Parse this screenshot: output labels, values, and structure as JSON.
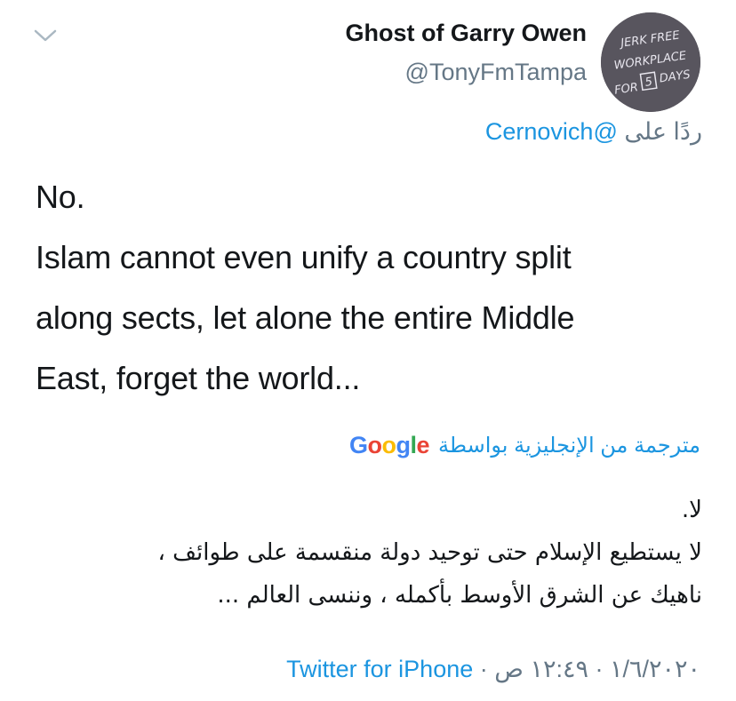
{
  "tweet": {
    "display_name": "Ghost of Garry Owen",
    "handle": "@TonyFmTampa",
    "avatar_text": [
      "JERK FREE",
      "WORKPLACE",
      "FOR",
      "5",
      "DAYS"
    ],
    "reply_prefix": "ردًا على",
    "reply_mention": "@Cernovich",
    "text_lines": [
      "No.",
      "Islam cannot even unify a country split",
      "along sects, let alone the entire Middle",
      "East, forget the world..."
    ],
    "translated_by_label": "مترجمة من الإنجليزية بواسطة",
    "google_logo_letters": [
      "G",
      "o",
      "o",
      "g",
      "l",
      "e"
    ],
    "google_colors": [
      "#4285F4",
      "#EA4335",
      "#FBBC05",
      "#4285F4",
      "#34A853",
      "#EA4335"
    ],
    "translation_lines": [
      "لا.",
      "لا يستطيع الإسلام حتى توحيد دولة منقسمة على طوائف ،",
      "ناهيك عن الشرق الأوسط بأكمله ، وننسى العالم ..."
    ],
    "footer_date": "١/٦/٢٠٢٠",
    "footer_time": "١٢:٤٩ ص",
    "footer_separator": "·",
    "footer_source": "Twitter for iPhone"
  },
  "colors": {
    "link": "#1b95e0",
    "secondary_text": "#657786",
    "primary_text": "#14171a"
  },
  "icons": {
    "menu": "chevron-down-icon"
  }
}
